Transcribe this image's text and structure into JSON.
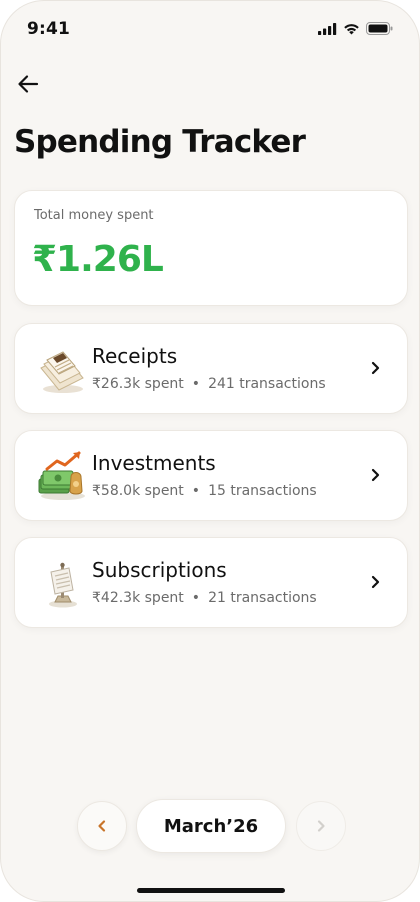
{
  "status_bar": {
    "time": "9:41"
  },
  "header": {
    "title": "Spending Tracker"
  },
  "total": {
    "label": "Total money spent",
    "value": "₹1.26L",
    "value_color": "#2fb24c"
  },
  "categories": [
    {
      "name": "Receipts",
      "spent": "₹26.3k spent",
      "transactions": "241 transactions",
      "icon": "receipt-icon"
    },
    {
      "name": "Investments",
      "spent": "₹58.0k spent",
      "transactions": "15 transactions",
      "icon": "investments-icon"
    },
    {
      "name": "Subscriptions",
      "spent": "₹42.3k spent",
      "transactions": "21 transactions",
      "icon": "subscriptions-icon"
    }
  ],
  "month_nav": {
    "label": "March’26",
    "prev_icon": "chevron-left-icon",
    "next_icon": "chevron-right-icon",
    "accent": "#c8742a"
  }
}
